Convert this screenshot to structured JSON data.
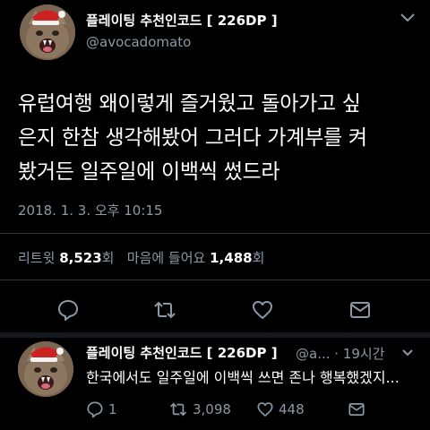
{
  "main_tweet": {
    "display_name": "플레이팅 추천인코드 [ 226DP ]",
    "handle": "@avocadomato",
    "text_lines": [
      "유럽여행 왜이렇게 즐거웠고 돌아가고 싶",
      "은지 한참 생각해봤어 그러다 가계부를 켜",
      "봤거든 일주일에 이백씩 썼드라"
    ],
    "timestamp": "2018. 1. 3. 오후 10:15",
    "retweets_label": "리트윗",
    "retweets_count": "8,523",
    "retweets_unit": "회",
    "likes_label": "마음에 들어요",
    "likes_count": "1,488",
    "likes_unit": "회",
    "actions": [
      "reply-icon",
      "retweet-icon",
      "like-icon",
      "share-icon"
    ]
  },
  "reply_tweet": {
    "display_name": "플레이팅 추천인코드 [ 226DP ]",
    "meta": "@a... · 19시간",
    "text": "한국에서도 일주일에 이백씩 쓰면 존나 행복했겠지...",
    "reply_count": "1",
    "retweet_count": "3,098",
    "like_count": "448"
  },
  "colors": {
    "background": "#000000",
    "text": "#ffffff",
    "secondary": "#8b98a5",
    "divider": "#2f3336",
    "icon": "#8b98a5"
  }
}
